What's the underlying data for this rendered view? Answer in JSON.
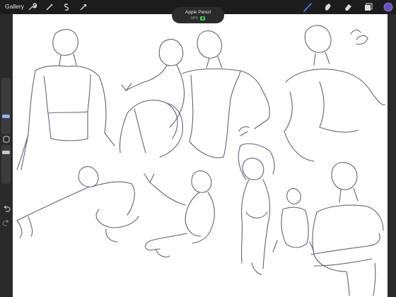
{
  "topbar": {
    "gallery_label": "Gallery",
    "tools": [
      "wrench-icon",
      "magic-wand-icon",
      "selection-icon",
      "transform-arrow-icon"
    ],
    "right_tools": [
      "brush-icon",
      "smudge-icon",
      "eraser-icon",
      "layers-icon",
      "color-swatch"
    ]
  },
  "toast": {
    "title": "Apple Pencil",
    "battery_percent": "98%"
  },
  "colors": {
    "accent": "#3f8ffe",
    "stroke": "#4a4664",
    "color_swatch": "#6a4fbf",
    "bar": "#1c1c1d"
  }
}
